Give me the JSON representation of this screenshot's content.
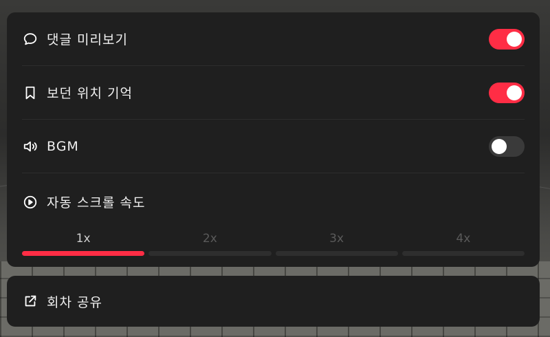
{
  "colors": {
    "accent": "#ff2d45",
    "panel": "#1f1f1f",
    "track_off": "#3a3a3a"
  },
  "settings": {
    "comment_preview": {
      "label": "댓글 미리보기",
      "icon": "comment-bubble-icon",
      "enabled": true
    },
    "reading_position": {
      "label": "보던 위치 기억",
      "icon": "bookmark-icon",
      "enabled": true
    },
    "bgm": {
      "label": "BGM",
      "icon": "speaker-icon",
      "enabled": false
    },
    "auto_scroll": {
      "label": "자동 스크롤 속도",
      "icon": "play-circle-icon",
      "options": [
        "1x",
        "2x",
        "3x",
        "4x"
      ],
      "selected": "1x"
    }
  },
  "share": {
    "label": "회차 공유",
    "icon": "external-link-icon"
  }
}
